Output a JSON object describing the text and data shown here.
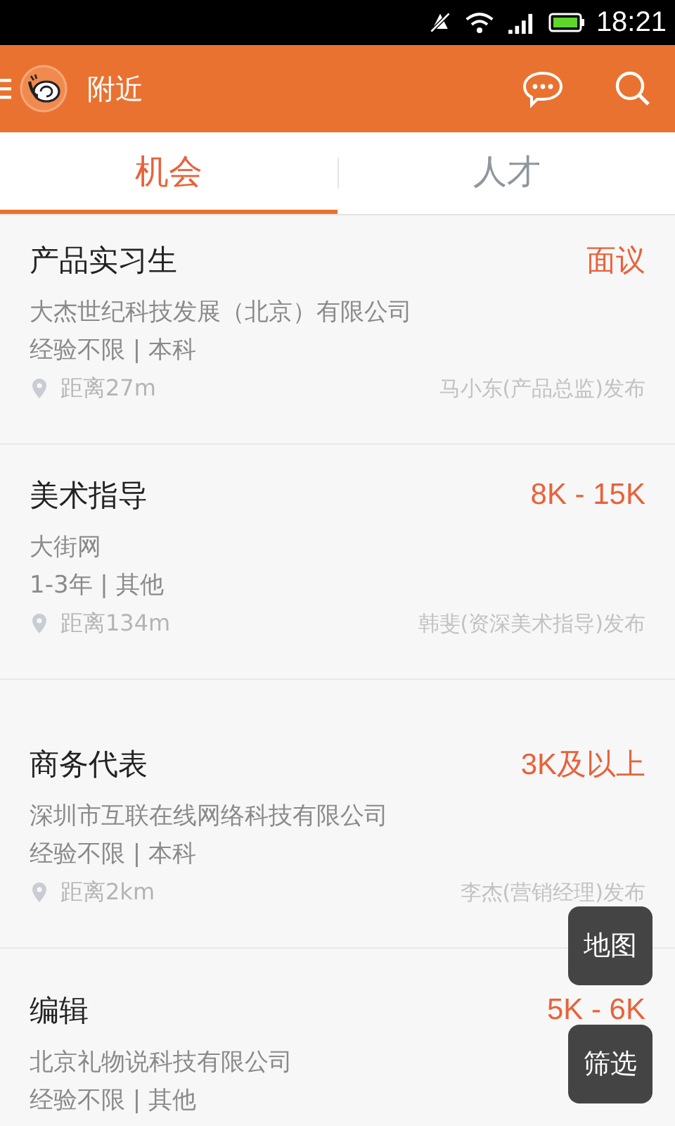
{
  "status_bar": {
    "time": "18:21"
  },
  "app_bar": {
    "title": "附近"
  },
  "tabs": [
    {
      "label": "机会",
      "selected": true
    },
    {
      "label": "人才",
      "selected": false
    }
  ],
  "jobs": [
    {
      "title": "产品实习生",
      "salary": "面议",
      "company": "大杰世纪科技发展（北京）有限公司",
      "requirements": "经验不限 | 本科",
      "distance": "距离27m",
      "poster": "马小东(产品总监)发布"
    },
    {
      "title": "美术指导",
      "salary": "8K - 15K",
      "company": "大街网",
      "requirements": "1-3年 | 其他",
      "distance": "距离134m",
      "poster": "韩斐(资深美术指导)发布"
    },
    {
      "title": "商务代表",
      "salary": "3K及以上",
      "company": "深圳市互联在线网络科技有限公司",
      "requirements": "经验不限 | 本科",
      "distance": "距离2km",
      "poster": "李杰(营销经理)发布"
    },
    {
      "title": "编辑",
      "salary": "5K - 6K",
      "company": "北京礼物说科技有限公司",
      "requirements": "经验不限 | 其他"
    }
  ],
  "floating_buttons": [
    "地图",
    "筛选"
  ]
}
